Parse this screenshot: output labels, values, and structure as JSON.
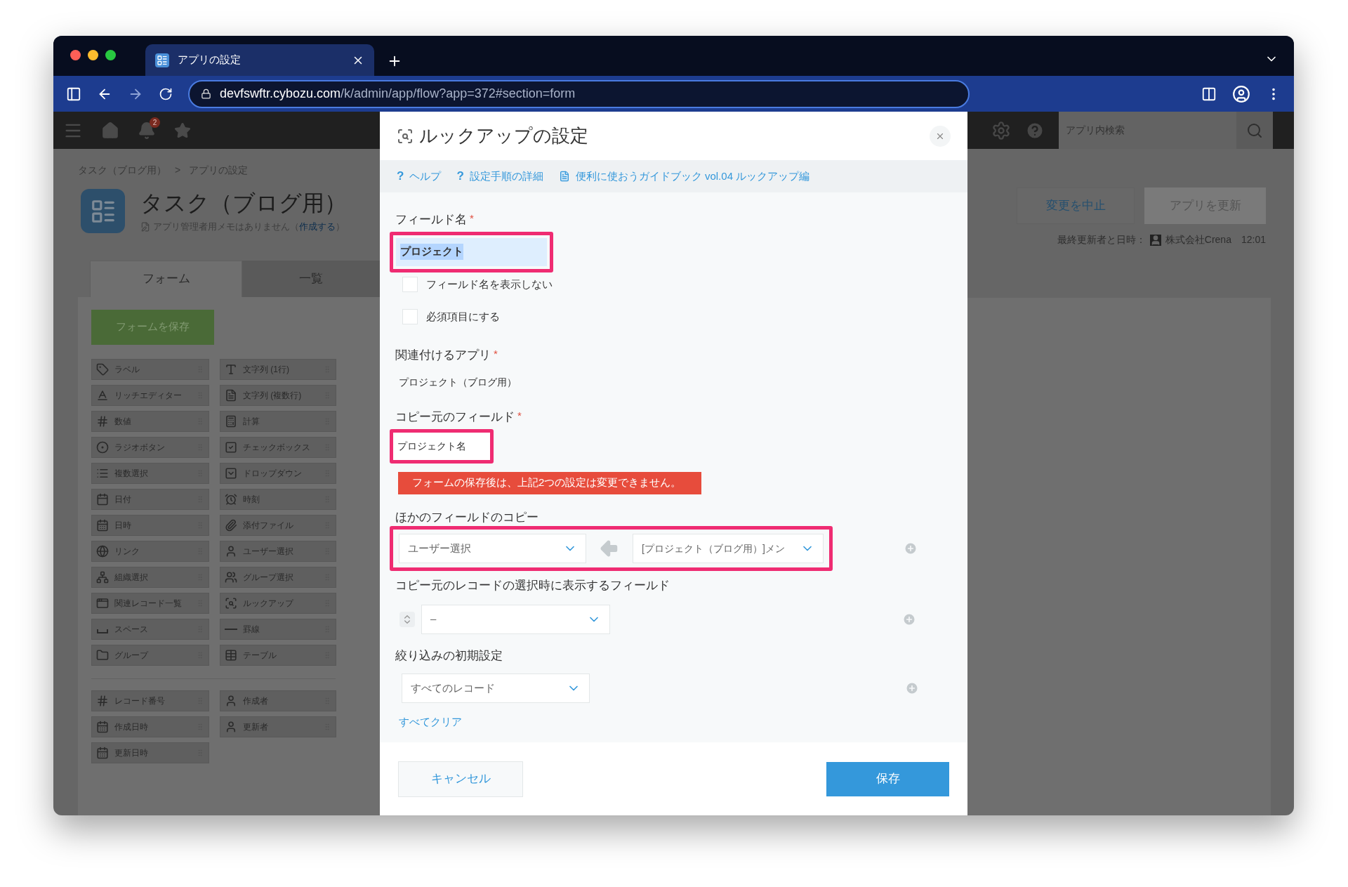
{
  "browser": {
    "tab_title": "アプリの設定",
    "url_host": "devfswftr.cybozu.com",
    "url_path": "/k/admin/app/flow?app=372#section=form"
  },
  "header": {
    "notification_count": "2",
    "search_placeholder": "アプリ内検索"
  },
  "breadcrumb": {
    "items": [
      "タスク（ブログ用）",
      "アプリの設定"
    ],
    "separator": ">"
  },
  "app": {
    "title": "タスク（ブログ用）",
    "memo": "アプリ管理者用メモはありません（",
    "memo_link": "作成する",
    "memo_end": "）"
  },
  "tabs": [
    {
      "label": "フォーム",
      "selected": true
    },
    {
      "label": "一覧",
      "selected": false
    }
  ],
  "save_form_button": "フォームを保存",
  "palette": [
    {
      "label": "ラベル",
      "kind": "tag"
    },
    {
      "label": "文字列 (1行)",
      "kind": "text"
    },
    {
      "label": "リッチエディター",
      "kind": "rich"
    },
    {
      "label": "文字列 (複数行)",
      "kind": "multiline"
    },
    {
      "label": "数値",
      "kind": "number"
    },
    {
      "label": "計算",
      "kind": "calc"
    },
    {
      "label": "ラジオボタン",
      "kind": "radio"
    },
    {
      "label": "チェックボックス",
      "kind": "checkbox"
    },
    {
      "label": "複数選択",
      "kind": "multi"
    },
    {
      "label": "ドロップダウン",
      "kind": "dropdown"
    },
    {
      "label": "日付",
      "kind": "date"
    },
    {
      "label": "時刻",
      "kind": "time"
    },
    {
      "label": "日時",
      "kind": "datetime"
    },
    {
      "label": "添付ファイル",
      "kind": "file"
    },
    {
      "label": "リンク",
      "kind": "link"
    },
    {
      "label": "ユーザー選択",
      "kind": "user"
    },
    {
      "label": "組織選択",
      "kind": "org"
    },
    {
      "label": "グループ選択",
      "kind": "group"
    },
    {
      "label": "関連レコード一覧",
      "kind": "related"
    },
    {
      "label": "ルックアップ",
      "kind": "lookup"
    },
    {
      "label": "スペース",
      "kind": "space"
    },
    {
      "label": "罫線",
      "kind": "rule"
    },
    {
      "label": "グループ",
      "kind": "folder"
    },
    {
      "label": "テーブル",
      "kind": "table"
    }
  ],
  "system_fields": [
    {
      "label": "レコード番号",
      "kind": "number"
    },
    {
      "label": "作成者",
      "kind": "user"
    },
    {
      "label": "作成日時",
      "kind": "datetime"
    },
    {
      "label": "更新者",
      "kind": "user"
    },
    {
      "label": "更新日時",
      "kind": "datetime"
    }
  ],
  "actions": {
    "cancel": "変更を中止",
    "update": "アプリを更新"
  },
  "last_updated": {
    "label": "最終更新者と日時：",
    "user": "株式会社Crena",
    "time": "12:01"
  },
  "dialog": {
    "title": "ルックアップの設定",
    "required_mark": "*",
    "links": [
      {
        "label": "ヘルプ",
        "kind": "help",
        "mark": "?"
      },
      {
        "label": "設定手順の詳細",
        "kind": "help",
        "mark": "?"
      },
      {
        "label": "便利に使おうガイドブック vol.04 ルックアップ編",
        "kind": "document"
      }
    ],
    "field_name": {
      "label": "フィールド名",
      "required": true,
      "value": "プロジェクト",
      "text_selected": true,
      "annotated": true
    },
    "checkboxes": [
      {
        "label": "フィールド名を表示しない",
        "checked": false
      },
      {
        "label": "必須項目にする",
        "checked": false
      }
    ],
    "related_app": {
      "label": "関連付けるアプリ",
      "required": true,
      "value": "プロジェクト（ブログ用）"
    },
    "source_field": {
      "label": "コピー元のフィールド",
      "required": true,
      "value": "プロジェクト名",
      "annotated": true
    },
    "warning": "フォームの保存後は、上記2つの設定は変更できません。",
    "field_mappings": {
      "label": "ほかのフィールドのコピー",
      "annotated": true,
      "rows": [
        {
          "target": "ユーザー選択",
          "source": "[プロジェクト（ブログ用）]メン"
        }
      ]
    },
    "display_fields": {
      "label": "コピー元のレコードの選択時に表示するフィールド",
      "rows": [
        {
          "value": "–"
        }
      ]
    },
    "filter": {
      "label": "絞り込みの初期設定",
      "value": "すべてのレコード",
      "clear_link": "すべてクリア"
    },
    "cancel": "キャンセル",
    "save": "保存"
  }
}
